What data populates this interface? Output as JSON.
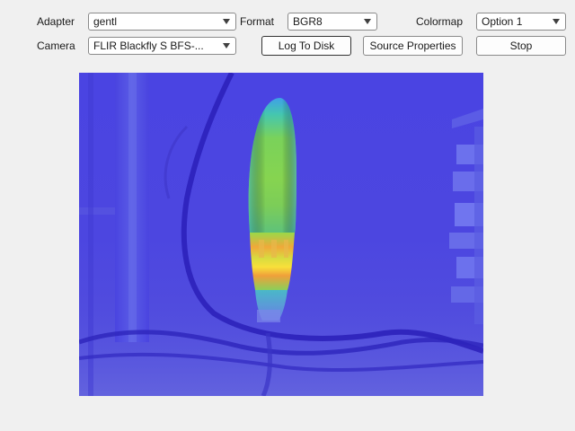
{
  "controls": {
    "adapter": {
      "label": "Adapter",
      "value": "gentl"
    },
    "camera": {
      "label": "Camera",
      "value": "FLIR Blackfly S BFS-..."
    },
    "format": {
      "label": "Format",
      "value": "BGR8"
    },
    "colormap": {
      "label": "Colormap",
      "value": "Option 1"
    }
  },
  "buttons": {
    "log_to_disk": "Log To Disk",
    "source_properties": "Source Properties",
    "stop": "Stop"
  },
  "preview": {
    "colormap_palette": [
      "#4038d8",
      "#3f6ee8",
      "#3ab8d8",
      "#6cd26a",
      "#c4e038",
      "#f5d23a"
    ]
  }
}
